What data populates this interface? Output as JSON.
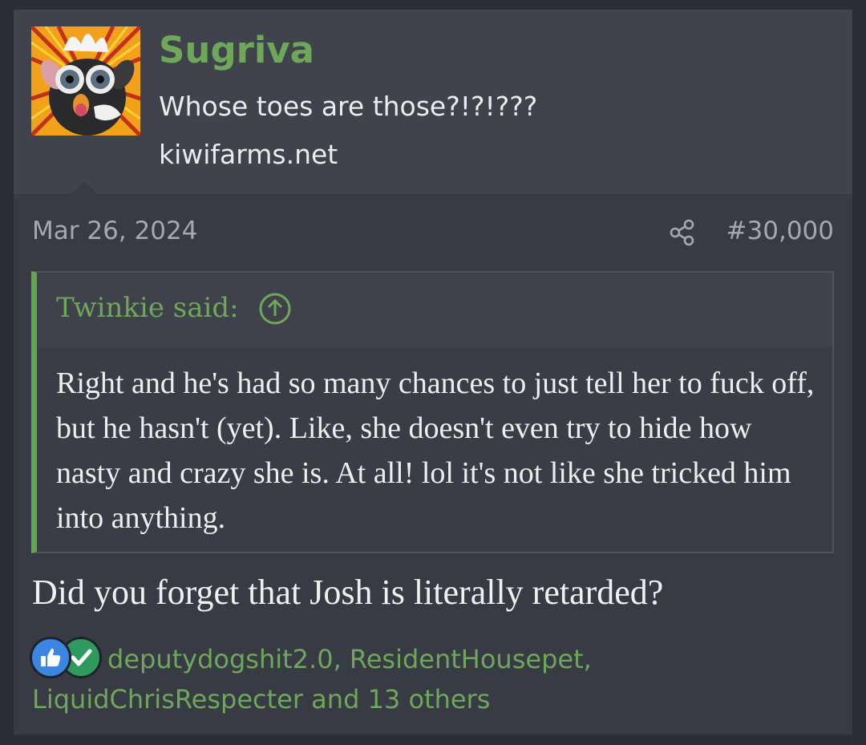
{
  "user": {
    "name": "Sugriva",
    "title": "Whose toes are those?!?!???",
    "site": "kiwifarms.net",
    "avatar_icon": "furby-avatar"
  },
  "post": {
    "date": "Mar 26, 2024",
    "number": "#30,000",
    "body": "Did you forget that Josh is literally retarded?"
  },
  "quote": {
    "author": "Twinkie said:",
    "text": "Right and he's had so many chances to just tell her to fuck off, but he hasn't (yet). Like, she doesn't even try to hide how nasty and crazy she is. At all! lol it's not like she tricked him into anything."
  },
  "reactions": {
    "icons": [
      "thumbs-up-icon",
      "check-icon"
    ],
    "text": "deputydogshit2.0, ResidentHousepet, LiquidChrisRespecter and 13 others"
  },
  "colors": {
    "background": "#383b43",
    "header": "#40434b",
    "accent_green": "#6ea75a",
    "quote_bar": "#5fa84c",
    "like_blue": "#3a86e2",
    "agree_green": "#2f9a5d"
  }
}
